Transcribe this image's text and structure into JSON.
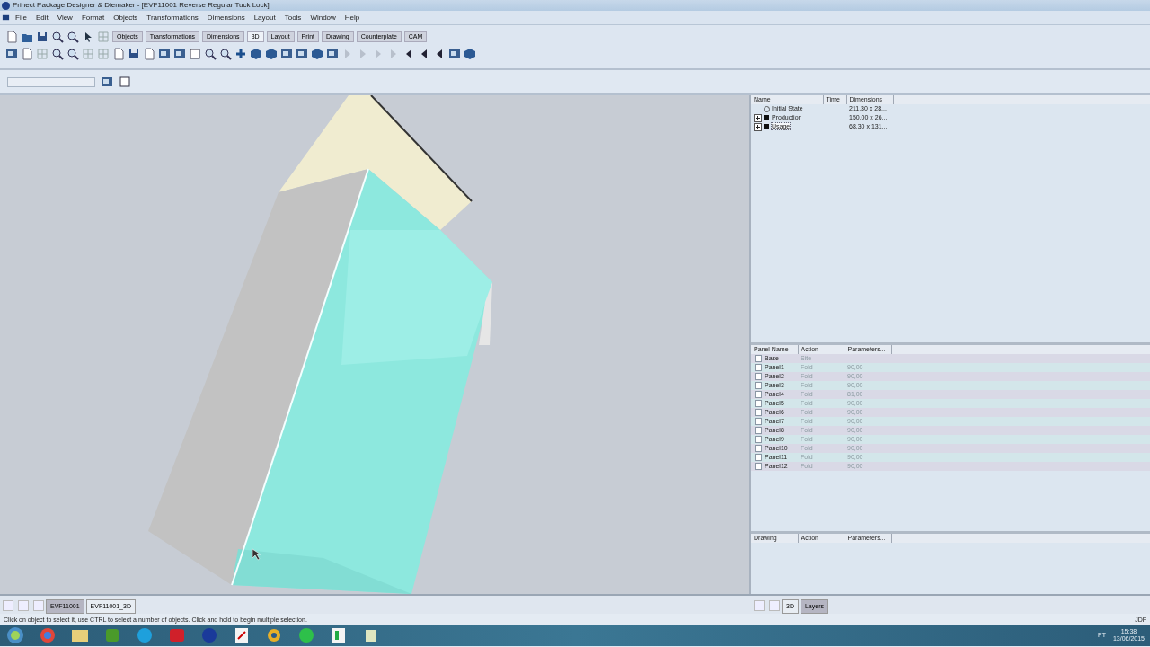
{
  "window": {
    "title": "Prinect Package Designer & Diemaker - [EVF11001 Reverse Regular Tuck Lock]"
  },
  "menu": [
    "File",
    "Edit",
    "View",
    "Format",
    "Objects",
    "Transformations",
    "Dimensions",
    "Layout",
    "Tools",
    "Window",
    "Help"
  ],
  "toolbar_tabs": [
    {
      "label": "Objects",
      "selected": false
    },
    {
      "label": "Transformations",
      "selected": false
    },
    {
      "label": "Dimensions",
      "selected": false
    },
    {
      "label": "3D",
      "selected": true
    },
    {
      "label": "Layout",
      "selected": false
    },
    {
      "label": "Print",
      "selected": false
    },
    {
      "label": "Drawing",
      "selected": false
    },
    {
      "label": "Counterplate",
      "selected": false
    },
    {
      "label": "CAM",
      "selected": false
    }
  ],
  "states_table": {
    "columns": [
      "Name",
      "Time",
      "Dimensions"
    ],
    "rows": [
      {
        "name": "Initial State",
        "dimensions": "211,30 x 28...",
        "expandable": false,
        "selected": false
      },
      {
        "name": "Production",
        "dimensions": "150,00 x 26...",
        "expandable": true,
        "selected": false
      },
      {
        "name": "Usage",
        "dimensions": "68,30 x 131...",
        "expandable": true,
        "selected": true
      }
    ]
  },
  "panels_table": {
    "columns": [
      "Panel Name",
      "Action",
      "Parameters..."
    ],
    "rows": [
      {
        "name": "Base",
        "action": "Site",
        "parameters": "",
        "checked": false
      },
      {
        "name": "Panel1",
        "action": "Fold",
        "parameters": "90,00",
        "checked": false
      },
      {
        "name": "Panel2",
        "action": "Fold",
        "parameters": "90,00",
        "checked": false
      },
      {
        "name": "Panel3",
        "action": "Fold",
        "parameters": "90,00",
        "checked": false
      },
      {
        "name": "Panel4",
        "action": "Fold",
        "parameters": "81,00",
        "checked": false
      },
      {
        "name": "Panel5",
        "action": "Fold",
        "parameters": "90,00",
        "checked": false
      },
      {
        "name": "Panel6",
        "action": "Fold",
        "parameters": "90,00",
        "checked": false
      },
      {
        "name": "Panel7",
        "action": "Fold",
        "parameters": "90,00",
        "checked": false
      },
      {
        "name": "Panel8",
        "action": "Fold",
        "parameters": "90,00",
        "checked": false
      },
      {
        "name": "Panel9",
        "action": "Fold",
        "parameters": "90,00",
        "checked": false
      },
      {
        "name": "Panel10",
        "action": "Fold",
        "parameters": "90,00",
        "checked": false
      },
      {
        "name": "Panel11",
        "action": "Fold",
        "parameters": "90,00",
        "checked": false
      },
      {
        "name": "Panel12",
        "action": "Fold",
        "parameters": "90,00",
        "checked": false
      }
    ]
  },
  "drawing_table": {
    "columns": [
      "Drawing",
      "Action",
      "Parameters..."
    ]
  },
  "document_tabs": [
    {
      "label": "EVF11001",
      "selected": true
    },
    {
      "label": "EVF11001_3D",
      "selected": false
    }
  ],
  "panel_tabs": [
    {
      "label": "3D",
      "selected": false
    },
    {
      "label": "Layers",
      "selected": true
    }
  ],
  "status_bar": {
    "message": "Click on object to select it, use CTRL to select a number of objects. Click and hold to begin multiple selection.",
    "indicator": "JDF"
  },
  "taskbar": {
    "language": "PT",
    "time": "15:38",
    "date": "13/06/2015"
  }
}
